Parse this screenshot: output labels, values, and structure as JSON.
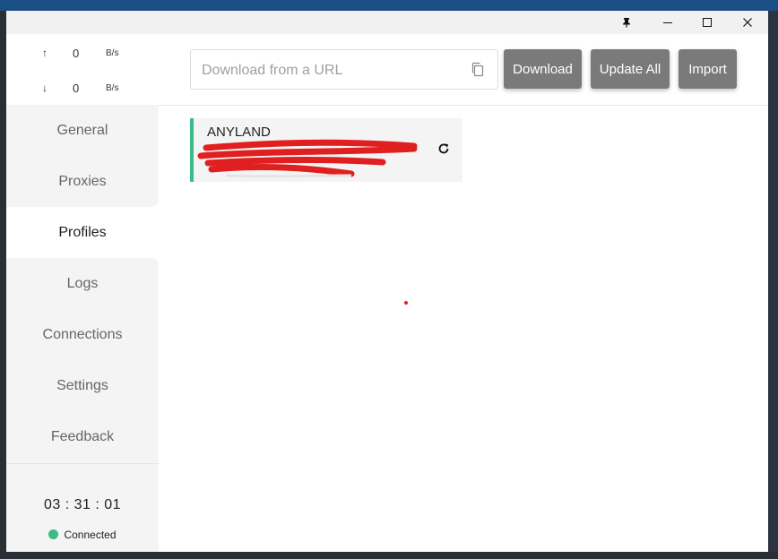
{
  "window": {
    "pin_icon": "pin-icon",
    "minimize_icon": "minimize-icon",
    "maximize_icon": "maximize-icon",
    "close_icon": "close-icon"
  },
  "traffic": {
    "upload_arrow": "↑",
    "upload_value": "0",
    "upload_unit": "B/s",
    "download_arrow": "↓",
    "download_value": "0",
    "download_unit": "B/s"
  },
  "nav": {
    "items": [
      {
        "label": "General"
      },
      {
        "label": "Proxies"
      },
      {
        "label": "Profiles"
      },
      {
        "label": "Logs"
      },
      {
        "label": "Connections"
      },
      {
        "label": "Settings"
      },
      {
        "label": "Feedback"
      }
    ],
    "active": "Profiles"
  },
  "footer": {
    "uptime": "03 : 31 : 01",
    "status": "Connected",
    "status_color": "#3dbb84"
  },
  "toolbar": {
    "url_placeholder": "Download from a URL",
    "url_value": "",
    "download_label": "Download",
    "update_all_label": "Update All",
    "import_label": "Import",
    "button_color": "#7a7a7a"
  },
  "profiles": [
    {
      "name": "ANYLAND",
      "accent": "#3dbb84",
      "refresh_icon": "refresh-icon",
      "details_redacted": true
    }
  ]
}
